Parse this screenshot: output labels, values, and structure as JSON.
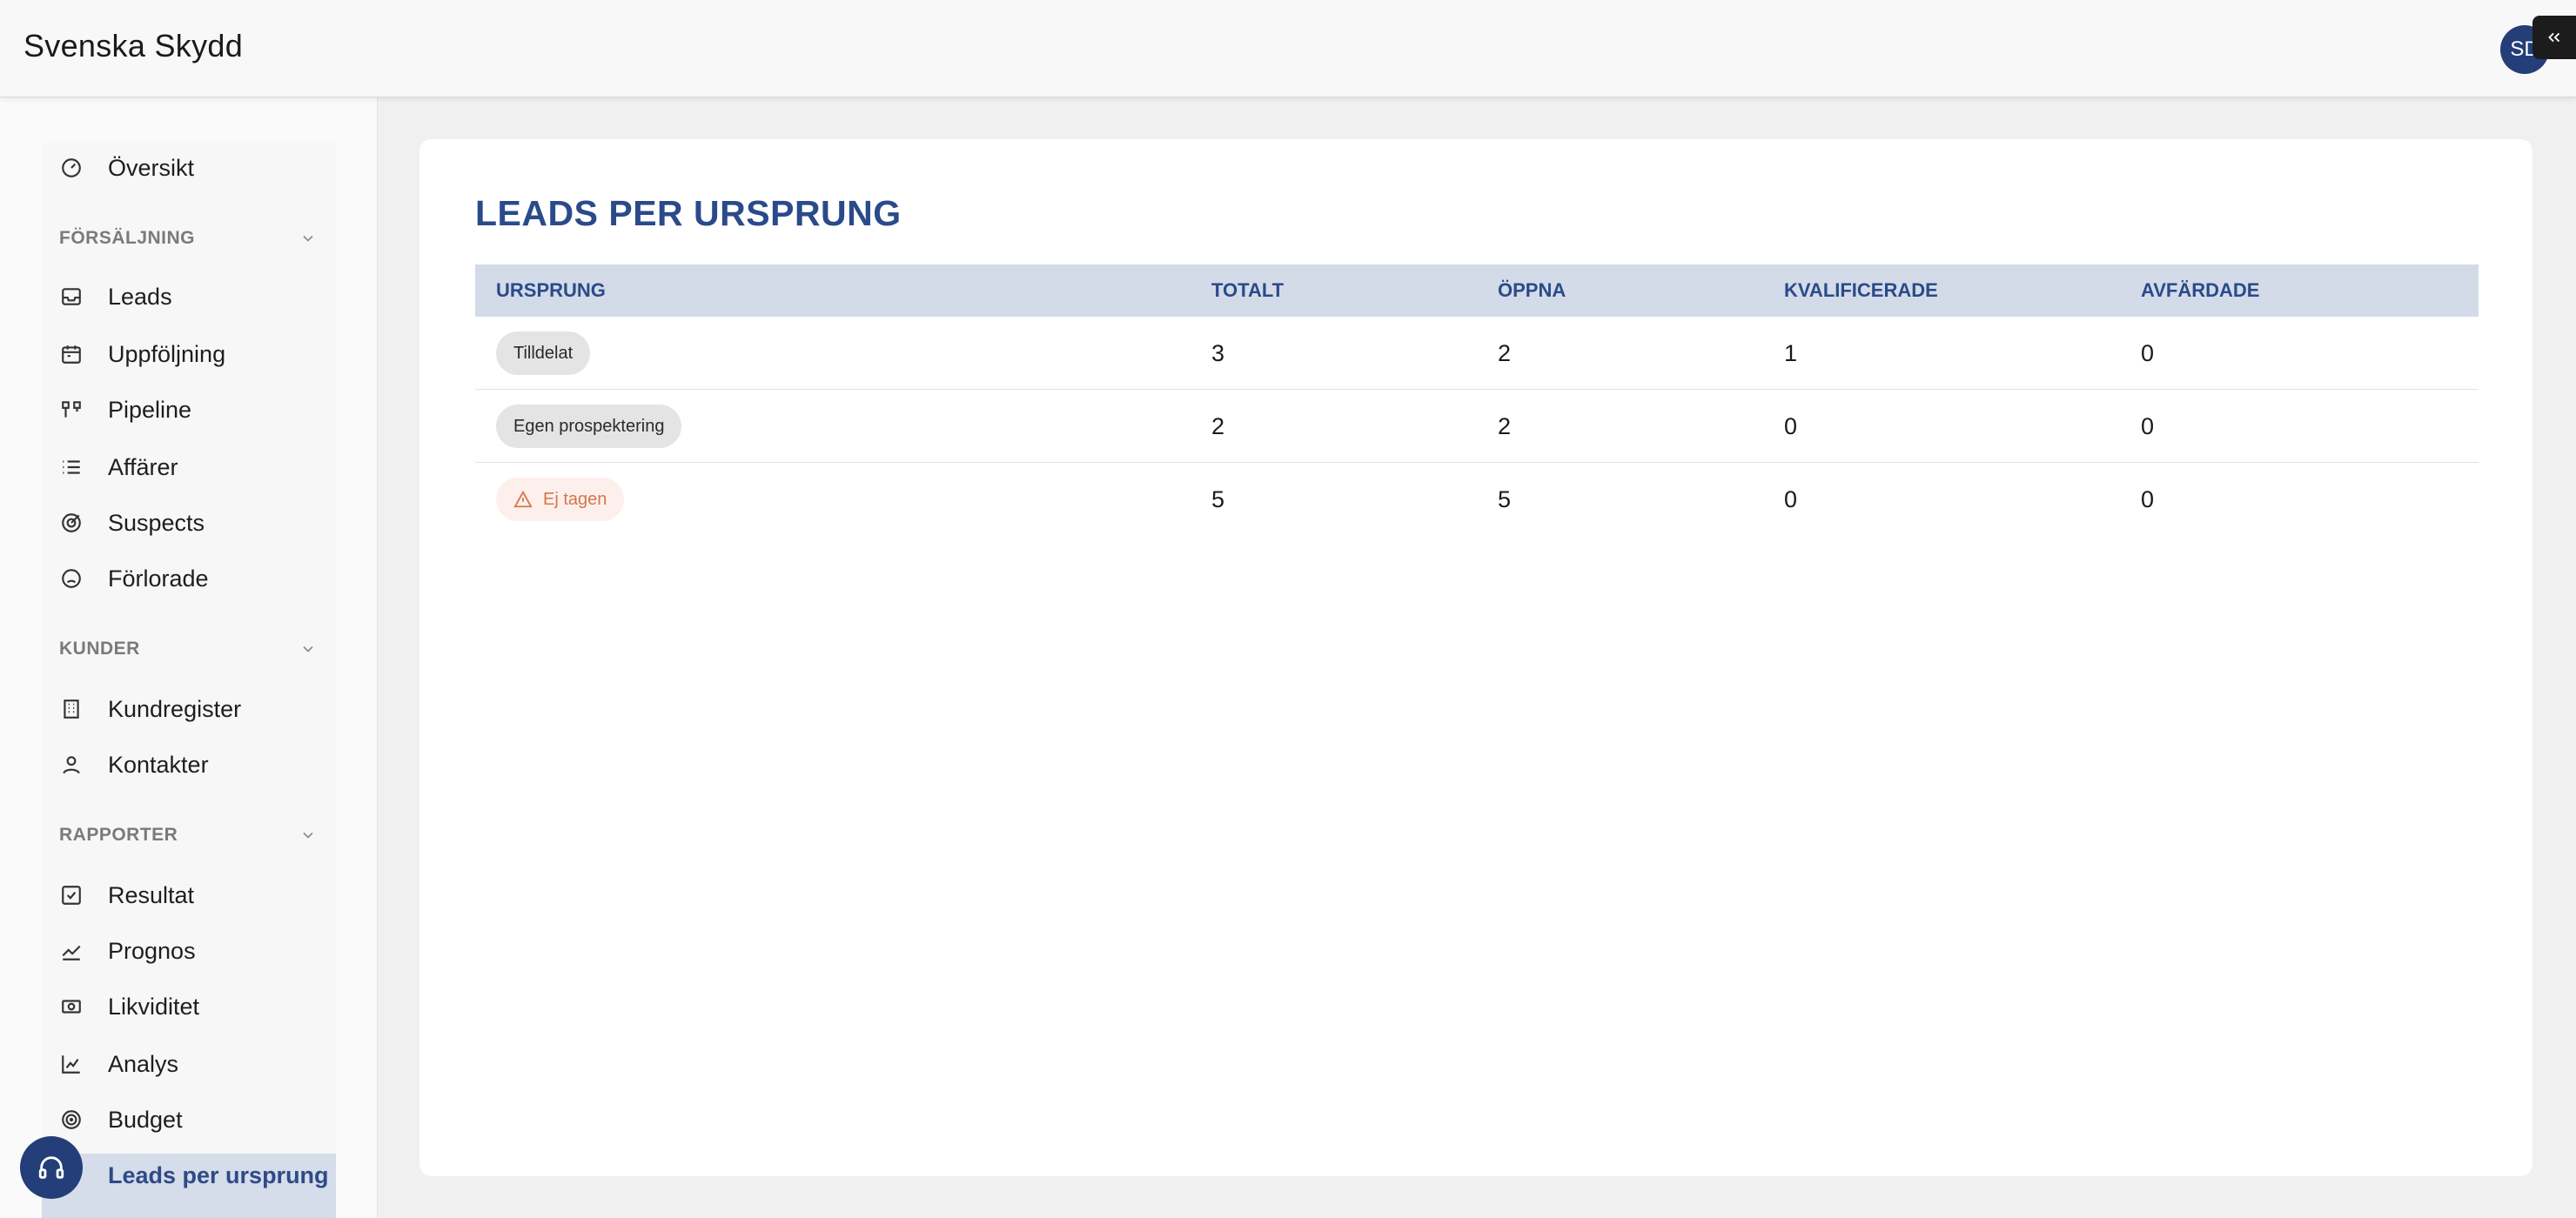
{
  "app": {
    "brand": "Svenska Skydd",
    "avatar_initials": "SD"
  },
  "sidebar": {
    "overview": "Översikt",
    "sections": [
      {
        "title": "FÖRSÄLJNING",
        "items": [
          "Leads",
          "Uppföljning",
          "Pipeline",
          "Affärer",
          "Suspects",
          "Förlorade"
        ]
      },
      {
        "title": "KUNDER",
        "items": [
          "Kundregister",
          "Kontakter"
        ]
      },
      {
        "title": "RAPPORTER",
        "items": [
          "Resultat",
          "Prognos",
          "Likviditet",
          "Analys",
          "Budget",
          "Leads per ursprung"
        ]
      }
    ]
  },
  "report": {
    "title": "LEADS PER URSPRUNG",
    "columns": [
      "URSPRUNG",
      "TOTALT",
      "ÖPPNA",
      "KVALIFICERADE",
      "AVFÄRDADE"
    ],
    "rows": [
      {
        "origin": "Tilldelat",
        "total": "3",
        "open": "2",
        "qualified": "1",
        "rejected": "0"
      },
      {
        "origin": "Egen prospektering",
        "total": "2",
        "open": "2",
        "qualified": "0",
        "rejected": "0"
      },
      {
        "origin": "Ej tagen",
        "total": "5",
        "open": "5",
        "qualified": "0",
        "rejected": "0"
      }
    ]
  },
  "colors": {
    "accent": "#2a4a8a",
    "header_bg": "#d3dbe8",
    "warning": "#d4764f"
  }
}
